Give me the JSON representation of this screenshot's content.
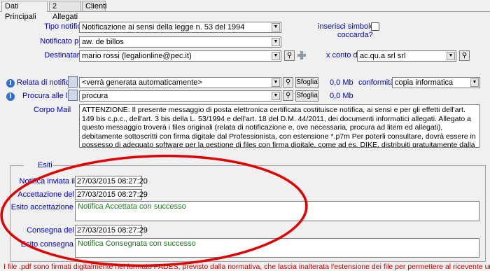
{
  "tabs": [
    "Dati Principali",
    "2 Allegati",
    "Clienti"
  ],
  "tipo_notifica": {
    "label": "Tipo notifica",
    "value": "Notificazione ai sensi della legge n. 53 del 1994"
  },
  "notificato_per": {
    "label": "Notificato per",
    "value": "aw. de billos"
  },
  "destinatario": {
    "label": "Destinatario",
    "value": "mario rossi (legalionline@pec.it)"
  },
  "simbolo": {
    "label_line1": "inserisci simbolo",
    "label_line2": "coccarda?"
  },
  "conto": {
    "label": "x conto di",
    "value": "ac.qu.a srl srl"
  },
  "relata": {
    "label": "Relata di notifica",
    "value": "<verrà generata automaticamente>",
    "browse": "Sfoglia",
    "size": "0,0 Mb"
  },
  "conformita": {
    "label": "conformità",
    "value": "copia informatica"
  },
  "procura": {
    "label": "Procura alle liti",
    "value": "procura",
    "browse": "Sfoglia",
    "size": "0,0 Mb"
  },
  "corpo": {
    "label": "Corpo Mail",
    "text": "ATTENZIONE: Il presente messaggio di posta elettronica certificata costituisce notifica, ai sensi e per gli effetti dell'art. 149 bis c.p.c., dell'art. 3 bis della L. 53/1994 e dell'art. 18 del D.M. 44/2011, dei documenti informatici allegati. Allegato a questo messaggio troverà i files originali (relata di notificazione e, ove necessaria, procura ad litem ed allegati), debitamente sottoscritti con firma digitale dal Professionista, con estensione *.p7m Per poterli consultare, dovrà essere in possesso di adeguato software per la gestione di files con firma digitale, come ad es. DIKE, distribuiti gratuitamente dalla maggior parte dei gestori di Firma Digitale (ad es. Infocert)."
  },
  "esiti": {
    "legend": "Esiti",
    "inviata_label": "Notifica inviata il",
    "inviata_value": "27/03/2015 08:27:20",
    "accettazione_label": "Accettazione del",
    "accettazione_value": "27/03/2015 08:27:29",
    "esito_acc_label": "Esito accettazione",
    "esito_acc_value": "Notifica Accettata con successo",
    "consegna_label": "Consegna del",
    "consegna_value": "27/03/2015 08:27:29",
    "esito_cons_label": "Esito consegna",
    "esito_cons_value": "Notifica Consegnata con successo"
  },
  "footer_note": "I file .pdf sono firmati digitalmente nel formato PADES, previsto dalla normativa, che lascia inalterata l'estensione dei file per permettere al ricevente una facile",
  "colors": {
    "label_blue": "#0000cc",
    "success_green": "#1a7a1a",
    "annotation_red": "#e00000",
    "footer_red": "#cc0000"
  }
}
